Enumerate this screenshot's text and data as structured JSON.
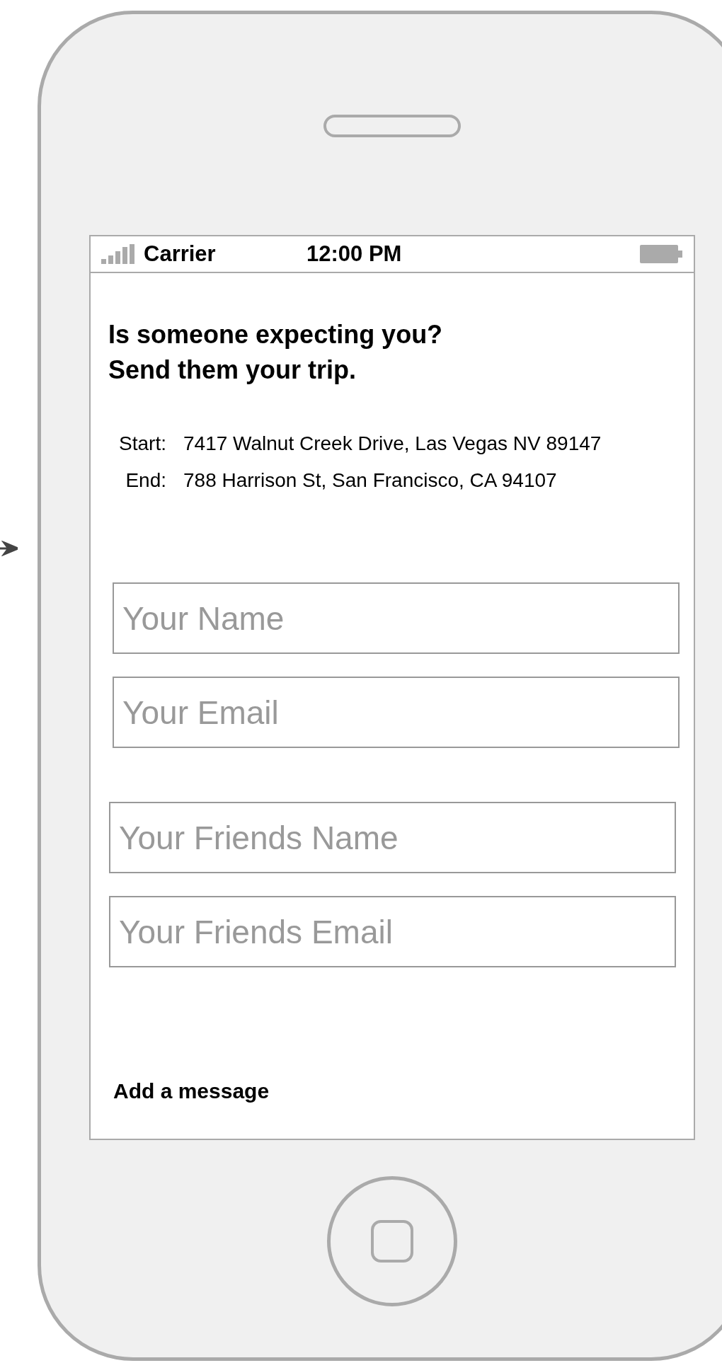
{
  "status_bar": {
    "carrier": "Carrier",
    "time": "12:00 PM"
  },
  "heading": [
    "Is someone expecting you?",
    "Send them your trip."
  ],
  "trip": [
    {
      "label": "Start:",
      "value": "7417 Walnut Creek Drive, Las Vegas NV 89147"
    },
    {
      "label": "End:",
      "value": "788 Harrison St, San Francisco, CA 94107"
    }
  ],
  "your_fields": [
    {
      "placeholder": "Your Name"
    },
    {
      "placeholder": "Your Email"
    }
  ],
  "friend_fields": [
    {
      "placeholder": "Your Friends Name"
    },
    {
      "placeholder": "Your Friends Email"
    }
  ],
  "add_message": "Add a message"
}
